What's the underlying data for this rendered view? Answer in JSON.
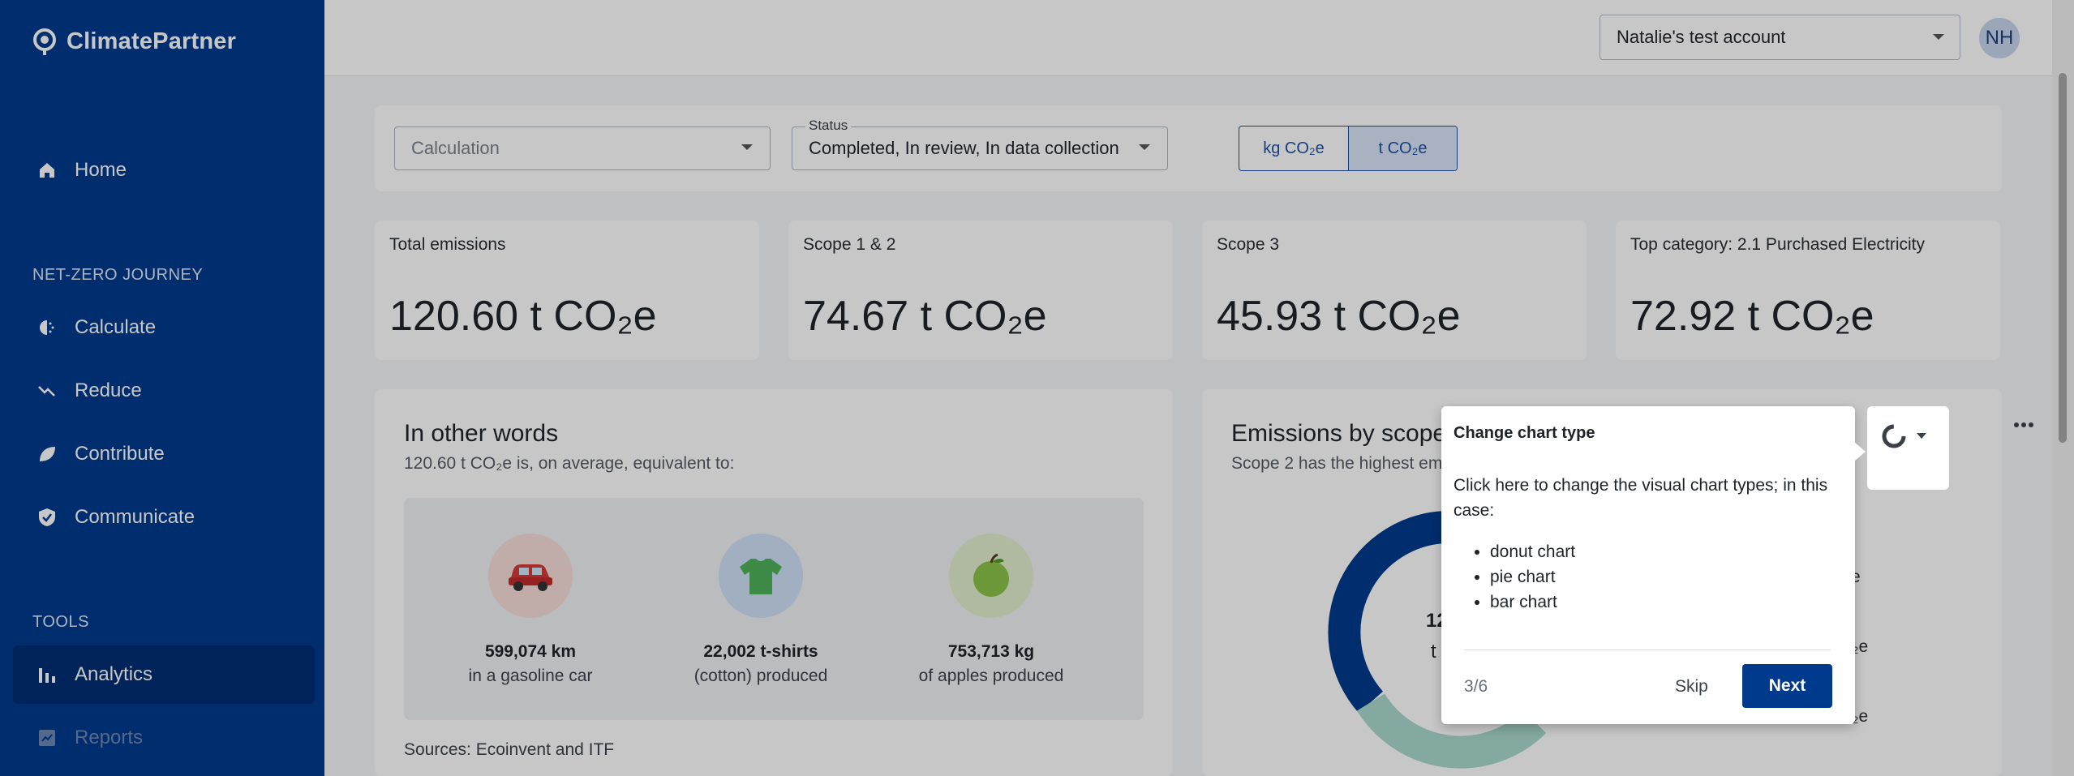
{
  "sidebar": {
    "brand": "ClimatePartner",
    "home": "Home",
    "section_netzero": "NET-ZERO JOURNEY",
    "items": [
      {
        "label": "Calculate"
      },
      {
        "label": "Reduce"
      },
      {
        "label": "Contribute"
      },
      {
        "label": "Communicate"
      }
    ],
    "section_tools": "TOOLS",
    "tools": [
      {
        "label": "Analytics",
        "active": true
      },
      {
        "label": "Reports"
      }
    ]
  },
  "header": {
    "account": "Natalie's test account",
    "avatar_initials": "NH"
  },
  "filters": {
    "calculation_placeholder": "Calculation",
    "status_label": "Status",
    "status_value": "Completed, In review, In data collection",
    "unit_kg": "kg CO₂e",
    "unit_t": "t CO₂e",
    "selected_unit": "t CO₂e"
  },
  "kpis": [
    {
      "label": "Total emissions",
      "value": "120.60 t CO₂e"
    },
    {
      "label": "Scope 1 & 2",
      "value": "74.67 t CO₂e"
    },
    {
      "label": "Scope 3",
      "value": "45.93 t CO₂e"
    },
    {
      "label": "Top category: 2.1 Purchased Electricity",
      "value": "72.92 t CO₂e"
    }
  ],
  "other_words": {
    "title": "In other words",
    "subtitle": "120.60 t CO₂e is, on average, equivalent to:",
    "items": [
      {
        "value": "599,074 km",
        "desc": "in a gasoline car",
        "icon": "car-icon"
      },
      {
        "value": "22,002 t-shirts",
        "desc": "(cotton) produced",
        "icon": "tshirt-icon"
      },
      {
        "value": "753,713 kg",
        "desc": "of apples produced",
        "icon": "apple-icon"
      }
    ],
    "sources": "Sources: Ecoinvent and ITF"
  },
  "emissions_card": {
    "title": "Emissions by scope",
    "subtitle": "Scope 2 has the highest em",
    "center_value": "12",
    "center_unit": "t",
    "legend_fragments": [
      "e",
      "O₂e",
      "O₂e"
    ],
    "colors": {
      "scope_primary": "#003a8c",
      "scope_secondary": "#a8d9cf"
    }
  },
  "tour": {
    "title": "Change chart type",
    "body": "Click here to change the visual chart types; in this case:",
    "options": [
      "donut chart",
      "pie chart",
      "bar chart"
    ],
    "step": "3/6",
    "skip": "Skip",
    "next": "Next"
  }
}
